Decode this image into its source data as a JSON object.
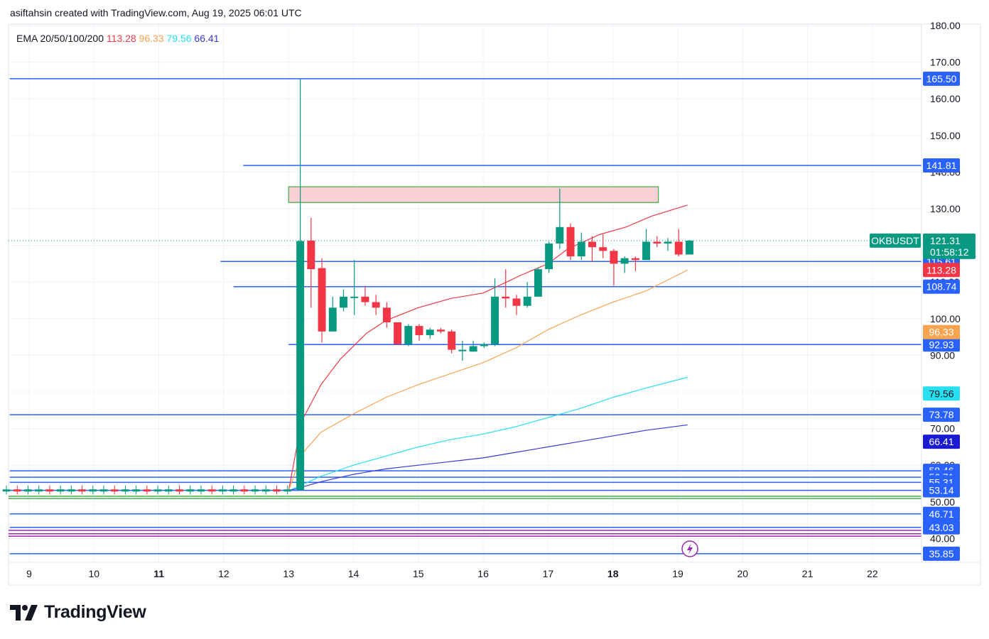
{
  "header": {
    "attribution": "asiftahsin created with TradingView.com, Aug 19, 2025 06:01 UTC"
  },
  "logo": {
    "text": "TradingView"
  },
  "colors": {
    "up": "#089981",
    "down": "#f23645",
    "hline": "#2962ff",
    "grid": "#f0f3fa",
    "axis_text": "#131722"
  },
  "chart_data": {
    "type": "candlestick",
    "symbol": "OKBUSDT",
    "last_price": "121.31",
    "countdown": "01:58:12",
    "indicator": {
      "name": "EMA 20/50/100/200",
      "values": [
        "113.28",
        "96.33",
        "79.56",
        "66.41"
      ],
      "colors": [
        "#f23645",
        "#f7a350",
        "#26e0f0",
        "#3a3ad9"
      ]
    },
    "ylim": [
      35.85,
      180
    ],
    "y_ticks": [
      "180.00",
      "170.00",
      "160.00",
      "150.00",
      "140.00",
      "130.00",
      "120.00",
      "110.00",
      "100.00",
      "90.00",
      "80.00",
      "70.00",
      "60.00",
      "50.00",
      "40.00"
    ],
    "x_ticks": [
      {
        "label": "9",
        "bold": false
      },
      {
        "label": "10",
        "bold": false
      },
      {
        "label": "11",
        "bold": true
      },
      {
        "label": "12",
        "bold": false
      },
      {
        "label": "13",
        "bold": false
      },
      {
        "label": "14",
        "bold": false
      },
      {
        "label": "15",
        "bold": false
      },
      {
        "label": "16",
        "bold": false
      },
      {
        "label": "17",
        "bold": false
      },
      {
        "label": "18",
        "bold": true
      },
      {
        "label": "19",
        "bold": false
      },
      {
        "label": "20",
        "bold": false
      },
      {
        "label": "21",
        "bold": false
      },
      {
        "label": "22",
        "bold": false
      }
    ],
    "x_start_day": 9,
    "candles_per_day": 6,
    "flat_period": {
      "open": 53.0,
      "close": 53.0,
      "high": 54.5,
      "low": 52.0
    },
    "candles": [
      {
        "o": 53.2,
        "h": 165.5,
        "l": 53.2,
        "c": 121.2
      },
      {
        "o": 121.3,
        "h": 127.5,
        "l": 103,
        "c": 113.5
      },
      {
        "o": 113.8,
        "h": 116.5,
        "l": 93.5,
        "c": 96.5
      },
      {
        "o": 96.5,
        "h": 106,
        "l": 96.5,
        "c": 103
      },
      {
        "o": 103,
        "h": 108,
        "l": 102,
        "c": 106
      },
      {
        "o": 106,
        "h": 116,
        "l": 101,
        "c": 106
      },
      {
        "o": 106,
        "h": 109,
        "l": 103.5,
        "c": 104.5
      },
      {
        "o": 104.5,
        "h": 106.5,
        "l": 101,
        "c": 103
      },
      {
        "o": 103,
        "h": 104.5,
        "l": 97.5,
        "c": 99
      },
      {
        "o": 99,
        "h": 99,
        "l": 93,
        "c": 93
      },
      {
        "o": 93,
        "h": 98.5,
        "l": 92.5,
        "c": 98
      },
      {
        "o": 98,
        "h": 98.5,
        "l": 94,
        "c": 95.5
      },
      {
        "o": 95.5,
        "h": 97.5,
        "l": 94.5,
        "c": 97
      },
      {
        "o": 97,
        "h": 97.5,
        "l": 96,
        "c": 96.5
      },
      {
        "o": 96.5,
        "h": 97,
        "l": 90.5,
        "c": 91.5
      },
      {
        "o": 91.5,
        "h": 94,
        "l": 88.5,
        "c": 91.5
      },
      {
        "o": 91,
        "h": 94,
        "l": 91,
        "c": 92.5
      },
      {
        "o": 92.5,
        "h": 93.5,
        "l": 92,
        "c": 93
      },
      {
        "o": 93,
        "h": 111,
        "l": 92.5,
        "c": 106
      },
      {
        "o": 106,
        "h": 113.5,
        "l": 103,
        "c": 105.5
      },
      {
        "o": 105.5,
        "h": 106.5,
        "l": 101,
        "c": 103.5
      },
      {
        "o": 103.5,
        "h": 110,
        "l": 103,
        "c": 106
      },
      {
        "o": 106,
        "h": 114,
        "l": 106,
        "c": 113.5
      },
      {
        "o": 113.5,
        "h": 121,
        "l": 112.5,
        "c": 120.5
      },
      {
        "o": 120.5,
        "h": 135.5,
        "l": 119,
        "c": 125
      },
      {
        "o": 125,
        "h": 126,
        "l": 116,
        "c": 117
      },
      {
        "o": 117,
        "h": 123.5,
        "l": 116,
        "c": 121
      },
      {
        "o": 121,
        "h": 122.5,
        "l": 115.5,
        "c": 119.5
      },
      {
        "o": 119.5,
        "h": 123,
        "l": 116.5,
        "c": 118.5
      },
      {
        "o": 118.5,
        "h": 119,
        "l": 109,
        "c": 115
      },
      {
        "o": 115,
        "h": 117,
        "l": 112.5,
        "c": 116.5
      },
      {
        "o": 116.5,
        "h": 117,
        "l": 113,
        "c": 116
      },
      {
        "o": 116,
        "h": 124.5,
        "l": 116,
        "c": 121
      },
      {
        "o": 121,
        "h": 122.5,
        "l": 119.5,
        "c": 120.5
      },
      {
        "o": 120.5,
        "h": 122,
        "l": 118.5,
        "c": 121
      },
      {
        "o": 121,
        "h": 124.5,
        "l": 117,
        "c": 117.5
      },
      {
        "o": 117.5,
        "h": 121.5,
        "l": 117.5,
        "c": 121.3
      }
    ],
    "ema_series": [
      {
        "x": [
          13.0,
          13.2,
          13.5,
          13.8,
          14.2,
          14.5,
          15.0,
          15.5,
          16.0,
          16.3,
          16.6,
          17.0,
          17.3,
          17.8,
          18.2,
          18.6,
          19.15
        ],
        "y": [
          53,
          72,
          82,
          89,
          96,
          99.5,
          103,
          105.5,
          107,
          109.5,
          112,
          115,
          119,
          123,
          125,
          128,
          131
        ],
        "color": "#f23645"
      },
      {
        "x": [
          13.0,
          13.2,
          13.5,
          14.0,
          14.5,
          15.0,
          15.5,
          16.0,
          16.5,
          17.0,
          17.5,
          18.0,
          18.5,
          19.15
        ],
        "y": [
          53,
          63,
          69,
          74,
          78.5,
          82,
          85,
          88,
          92,
          97,
          101,
          104.5,
          107.5,
          113.28
        ],
        "color": "#f7a350"
      },
      {
        "x": [
          13.0,
          13.5,
          14.0,
          14.5,
          15.0,
          15.5,
          16.0,
          16.5,
          17.0,
          17.5,
          18.0,
          18.5,
          19.15
        ],
        "y": [
          53,
          57,
          60,
          62.5,
          65,
          67,
          68.5,
          70.5,
          73,
          75.5,
          78.5,
          81,
          84
        ],
        "color": "#26e0f0"
      },
      {
        "x": [
          13.0,
          13.5,
          14.0,
          14.5,
          15.0,
          15.5,
          16.0,
          16.5,
          17.0,
          17.5,
          18.0,
          18.5,
          19.15
        ],
        "y": [
          53,
          55.5,
          57.5,
          59,
          60,
          61,
          62,
          63.5,
          65,
          66.5,
          68,
          69.5,
          71
        ],
        "color": "#3a3ad9"
      }
    ],
    "horizontal_levels": [
      {
        "value": 165.5,
        "label": "165.50",
        "start_day": 8.7,
        "color": "#2962ff"
      },
      {
        "value": 141.81,
        "label": "141.81",
        "start_day": 12.3,
        "color": "#2962ff"
      },
      {
        "value": 115.61,
        "label": "115.61",
        "start_day": 11.95,
        "color": "#2962ff"
      },
      {
        "value": 108.74,
        "label": "108.74",
        "start_day": 12.15,
        "color": "#2962ff"
      },
      {
        "value": 92.93,
        "label": "92.93",
        "start_day": 13.0,
        "color": "#2962ff"
      },
      {
        "value": 73.78,
        "label": "73.78",
        "start_day": 8.7,
        "color": "#2962ff"
      },
      {
        "value": 58.46,
        "label": "58.46",
        "start_day": 8.7,
        "color": "#2962ff"
      },
      {
        "value": 56.71,
        "label": "56.71",
        "start_day": 8.7,
        "color": "#2962ff"
      },
      {
        "value": 55.31,
        "label": "55.31",
        "start_day": 8.7,
        "color": "#2962ff"
      },
      {
        "value": 53.14,
        "label": "53.14",
        "start_day": 8.7,
        "color": "#2962ff"
      },
      {
        "value": 46.71,
        "label": "46.71",
        "start_day": 8.7,
        "color": "#2962ff"
      },
      {
        "value": 43.03,
        "label": "43.03",
        "start_day": 8.7,
        "color": "#2962ff"
      },
      {
        "value": 35.85,
        "label": "35.85",
        "start_day": 8.7,
        "color": "#2962ff"
      }
    ],
    "extra_lines": [
      {
        "value": 51.5,
        "color": "#4caf50"
      },
      {
        "value": 50.9,
        "color": "#4caf50"
      },
      {
        "value": 42.2,
        "color": "#9c27b0"
      },
      {
        "value": 41.3,
        "color": "#9c27b0"
      },
      {
        "value": 40.6,
        "color": "#9c27b0"
      }
    ],
    "zone": {
      "x0": 13.0,
      "x1": 18.7,
      "y0": 131.7,
      "y1": 136.0,
      "fill": "#f8d0d6",
      "stroke": "#4caf50"
    },
    "price_tags": [
      {
        "label": "121.31",
        "value": 121.31,
        "bg": "#089981",
        "fg": "#ffffff"
      },
      {
        "label": "113.28",
        "value": 113.28,
        "bg": "#f23645",
        "fg": "#ffffff"
      },
      {
        "label": "96.33",
        "value": 96.33,
        "bg": "#f7a350",
        "fg": "#ffffff"
      },
      {
        "label": "79.56",
        "value": 79.56,
        "bg": "#26e0f0",
        "fg": "#131722"
      },
      {
        "label": "66.41",
        "value": 66.41,
        "bg": "#1a1ad1",
        "fg": "#ffffff"
      }
    ]
  }
}
